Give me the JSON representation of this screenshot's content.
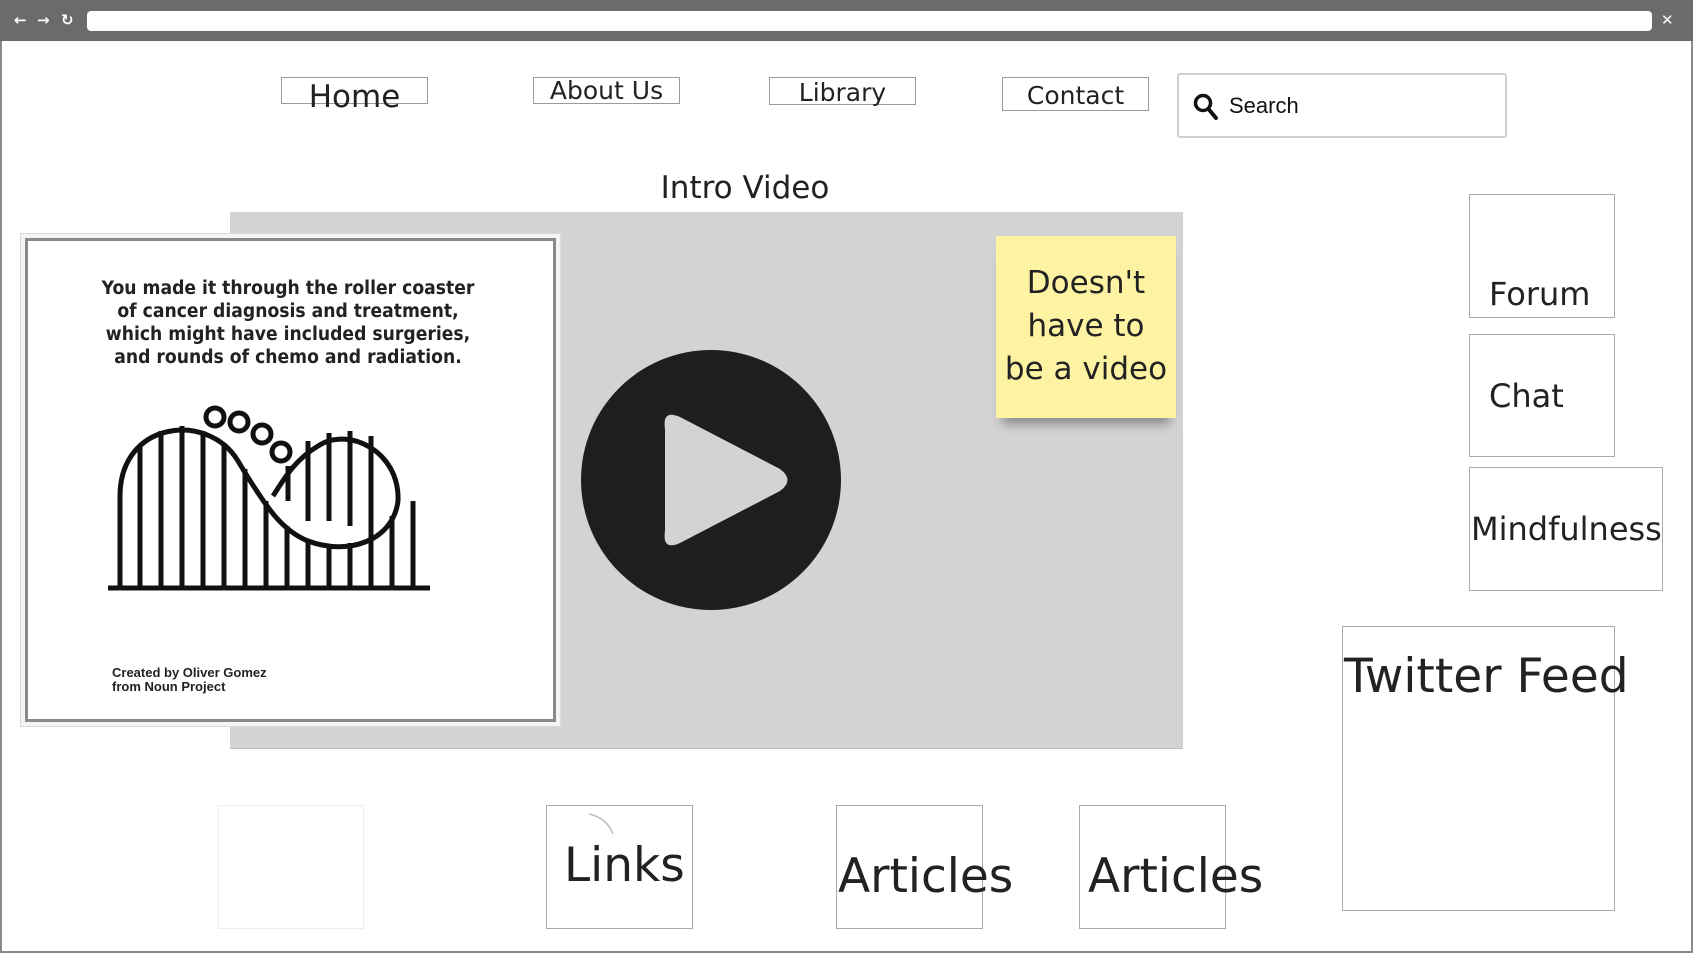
{
  "browser": {
    "back_glyph": "←",
    "forward_glyph": "→",
    "reload_glyph": "↻",
    "close_glyph": "✕"
  },
  "nav": {
    "home": "Home",
    "about": "About Us",
    "library": "Library",
    "contact": "Contact"
  },
  "search": {
    "placeholder": "Search",
    "icon": "search-icon"
  },
  "main": {
    "video_title": "Intro Video",
    "video_icon": "play-icon",
    "sticky_note": "Doesn't\nhave to\nbe a video",
    "image_quote": "You made it through the roller coaster\nof cancer diagnosis and treatment,\nwhich might have included surgeries,\nand rounds of chemo and radiation.",
    "image_credit": "Created by Oliver Gomez\nfrom Noun Project",
    "image_icon": "roller-coaster-icon"
  },
  "sidebar": {
    "forum": "Forum",
    "chat": "Chat",
    "mindfulness": "Mindfulness",
    "twitter": "Twitter Feed"
  },
  "bottom": {
    "links": "Links",
    "articles_1": "Articles",
    "articles_2": "Articles"
  },
  "colors": {
    "chrome": "#6b6b6b",
    "video_bg": "#d3d3d3",
    "sticky": "#fdf3a3",
    "play": "#1e1e1e"
  }
}
